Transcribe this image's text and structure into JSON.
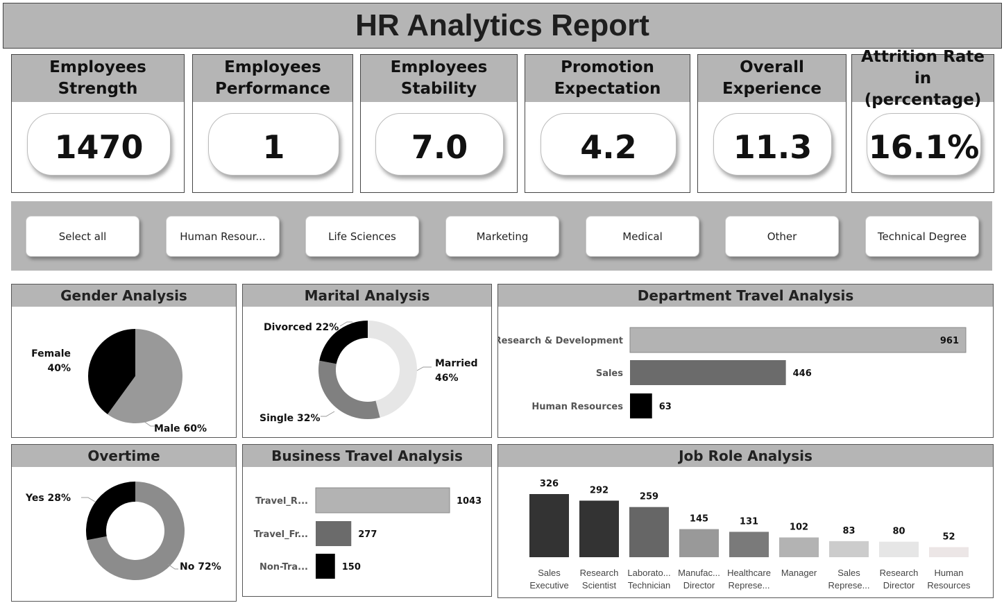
{
  "title": "HR Analytics Report",
  "kpis": [
    {
      "label": "Employees\nStrength",
      "value": "1470"
    },
    {
      "label": "Employees\nPerformance",
      "value": "1"
    },
    {
      "label": "Employees\nStability",
      "value": "7.0"
    },
    {
      "label": "Promotion\nExpectation",
      "value": "4.2"
    },
    {
      "label": "Overall\nExperience",
      "value": "11.3"
    },
    {
      "label": "Attrition Rate in\n(percentage)",
      "value": "16.1%"
    }
  ],
  "slicer": {
    "options": [
      "Select all",
      "Human Resour...",
      "Life Sciences",
      "Marketing",
      "Medical",
      "Other",
      "Technical Degree"
    ]
  },
  "panels": {
    "gender": "Gender Analysis",
    "marital": "Marital Analysis",
    "department": "Department Travel Analysis",
    "overtime": "Overtime",
    "business": "Business Travel Analysis",
    "jobrole": "Job Role Analysis"
  },
  "colors": {
    "header_gray": "#b5b5b5",
    "black": "#000000",
    "mid_gray": "#8c8c8c",
    "dark_gray": "#666666",
    "light_gray": "#e6e6e6"
  },
  "chart_data": [
    {
      "id": "gender",
      "type": "pie",
      "title": "Gender Analysis",
      "slices": [
        {
          "name": "Female",
          "value": 40,
          "label_name": "Female",
          "label_pct": "40%",
          "color": "#000000"
        },
        {
          "name": "Male",
          "value": 60,
          "label_name": "Male",
          "label_pct": "60%",
          "color": "#999999"
        }
      ]
    },
    {
      "id": "marital",
      "type": "pie",
      "title": "Marital Analysis",
      "donut": true,
      "slices": [
        {
          "name": "Married",
          "value": 46,
          "label_name": "Married",
          "label_pct": "46%",
          "color": "#e6e6e6"
        },
        {
          "name": "Single",
          "value": 32,
          "label_name": "Single",
          "label_pct": "32%",
          "color": "#808080"
        },
        {
          "name": "Divorced",
          "value": 22,
          "label_name": "Divorced",
          "label_pct": "22%",
          "color": "#000000"
        }
      ]
    },
    {
      "id": "department",
      "type": "bar",
      "orientation": "horizontal",
      "title": "Department Travel Analysis",
      "categories": [
        "Research & Development",
        "Sales",
        "Human Resources"
      ],
      "values": [
        961,
        446,
        63
      ],
      "colors": [
        "#b3b3b3",
        "#6b6b6b",
        "#000000"
      ],
      "xlim": [
        0,
        961
      ]
    },
    {
      "id": "overtime",
      "type": "pie",
      "title": "Overtime",
      "donut": true,
      "slices": [
        {
          "name": "No",
          "value": 72,
          "label_name": "No",
          "label_pct": "72%",
          "color": "#8c8c8c"
        },
        {
          "name": "Yes",
          "value": 28,
          "label_name": "Yes",
          "label_pct": "28%",
          "color": "#000000"
        }
      ]
    },
    {
      "id": "business",
      "type": "bar",
      "orientation": "horizontal",
      "title": "Business Travel Analysis",
      "categories": [
        "Travel_R...",
        "Travel_Fr...",
        "Non-Tra..."
      ],
      "values": [
        1043,
        277,
        150
      ],
      "colors": [
        "#b3b3b3",
        "#6b6b6b",
        "#000000"
      ],
      "xlim": [
        0,
        1043
      ]
    },
    {
      "id": "jobrole",
      "type": "bar",
      "title": "Job Role Analysis",
      "categories": [
        [
          "Sales",
          "Executive"
        ],
        [
          "Research",
          "Scientist"
        ],
        [
          "Laborato...",
          "Technician"
        ],
        [
          "Manufac...",
          "Director"
        ],
        [
          "Healthcare",
          "Represe..."
        ],
        [
          "Manager",
          ""
        ],
        [
          "Sales",
          "Represe..."
        ],
        [
          "Research",
          "Director"
        ],
        [
          "Human",
          "Resources"
        ]
      ],
      "values": [
        326,
        292,
        259,
        145,
        131,
        102,
        83,
        80,
        52
      ],
      "colors": [
        "#333333",
        "#333333",
        "#666666",
        "#999999",
        "#7a7a7a",
        "#b3b3b3",
        "#cccccc",
        "#e6e6e6",
        "#ece6e6"
      ],
      "ylim": [
        0,
        326
      ]
    }
  ]
}
